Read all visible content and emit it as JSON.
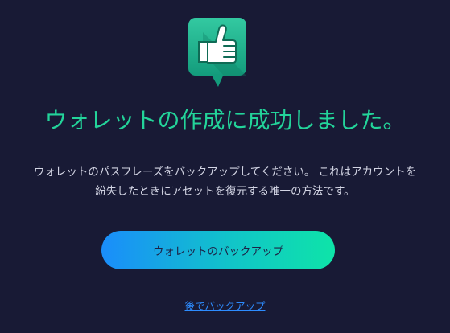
{
  "success": {
    "icon": "thumbs-up-icon",
    "title": "ウォレットの作成に成功しました。",
    "description_line1": "ウォレットのパスフレーズをバックアップしてください。 これはアカウントを",
    "description_line2": "紛失したときにアセットを復元する唯一の方法です。"
  },
  "actions": {
    "backup_label": "ウォレットのバックアップ",
    "later_label": "後でバックアップ"
  },
  "colors": {
    "background": "#181a35",
    "accent": "#23d49a",
    "link": "#2d8cff"
  }
}
